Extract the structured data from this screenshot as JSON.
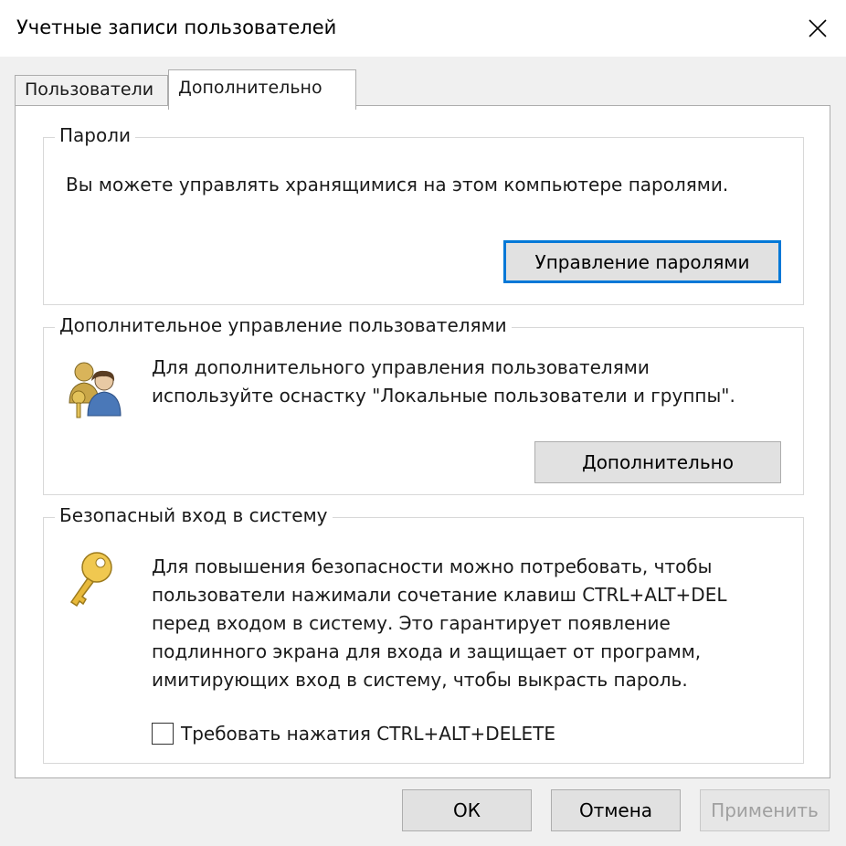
{
  "window": {
    "title": "Учетные записи пользователей"
  },
  "tabs": [
    {
      "label": "Пользователи",
      "active": false
    },
    {
      "label": "Дополнительно",
      "active": true
    }
  ],
  "passwords_group": {
    "legend": "Пароли",
    "text": "Вы можете управлять хранящимися на этом компьютере паролями.",
    "button_label": "Управление паролями"
  },
  "advanced_users_group": {
    "legend": "Дополнительное управление пользователями",
    "text": "Для дополнительного управления пользователями\nиспользуйте оснастку \"Локальные пользователи и группы\".",
    "button_label": "Дополнительно",
    "icon": "users-icon"
  },
  "secure_login_group": {
    "legend": "Безопасный вход в систему",
    "text": "Для повышения безопасности можно потребовать, чтобы\nпользователи нажимали сочетание клавиш CTRL+ALT+DEL\nперед входом в систему. Это гарантирует появление\nподлинного экрана для входа и защищает от программ,\nимитирующих вход в систему, чтобы выкрасть пароль.",
    "checkbox_label": "Требовать нажатия CTRL+ALT+DELETE",
    "checkbox_checked": false,
    "icon": "key-icon"
  },
  "footer": {
    "ok_label": "ОК",
    "cancel_label": "Отмена",
    "apply_label": "Применить"
  }
}
